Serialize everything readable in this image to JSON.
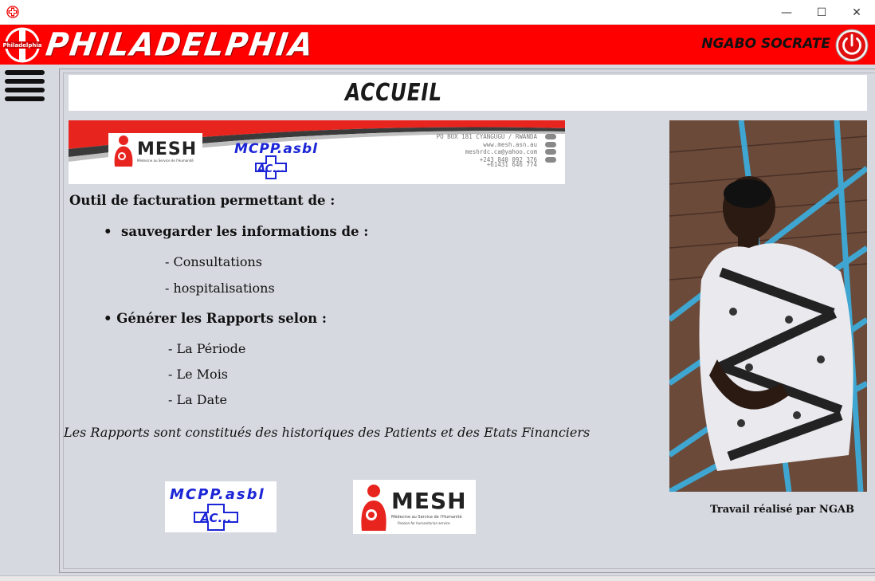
{
  "window": {
    "minimize": "—",
    "maximize": "☐",
    "close": "✕"
  },
  "header": {
    "app_name": "PHILADELPHIA",
    "logo_text": "Philadelphia",
    "user": "NGABO SOCRATE"
  },
  "page": {
    "title": "ACCUEIL"
  },
  "banner": {
    "mesh_name": "MESH",
    "mesh_sub": "Médecine au Service de l'Humanité",
    "mesh_tag": "Passion for humanitarian service",
    "mcpp_name": "MCPP.asbl",
    "contact": [
      "PO BOX 181 CYANGUGU / RWANDA",
      "www.mesh.asn.au",
      "meshrdc.ca@yahoo.com",
      "+243 840 092 376",
      "+61431 646 774"
    ]
  },
  "content": {
    "intro": "Outil de facturation permettant de :",
    "bullet1": "sauvegarder les informations de :",
    "bullet1_items": [
      "- Consultations",
      "- hospitalisations"
    ],
    "bullet2": "Générer les Rapports selon :",
    "bullet2_items": [
      "- La Période",
      "- Le Mois",
      "- La Date"
    ],
    "footer_note": "Les Rapports sont constitués des historiques des Patients et des Etats Financiers"
  },
  "credit": "Travail réalisé par NGAB",
  "colors": {
    "header_red": "#ff0000",
    "panel_bg": "#d6d9e0",
    "mcpp_blue": "#1b25d6",
    "mesh_red": "#e8241e"
  },
  "icons": [
    "app-cross-icon",
    "philadelphia-logo",
    "power-icon",
    "hamburger-menu-icon",
    "mesh-mother-child-icon",
    "mcpp-cross-icon"
  ]
}
